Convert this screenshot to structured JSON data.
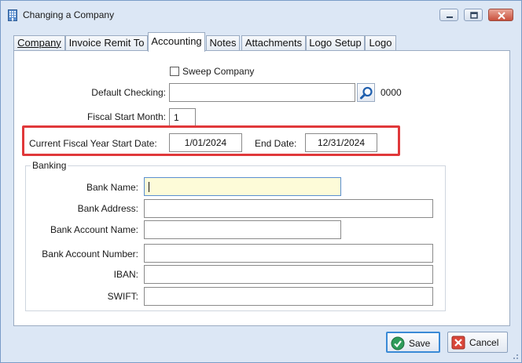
{
  "window": {
    "title": "Changing a Company",
    "icon": "building-icon"
  },
  "tabs": [
    {
      "label": "Company",
      "active": false
    },
    {
      "label": "Invoice Remit To",
      "active": false
    },
    {
      "label": "Accounting",
      "active": true
    },
    {
      "label": "Notes",
      "active": false
    },
    {
      "label": "Attachments",
      "active": false
    },
    {
      "label": "Logo Setup",
      "active": false
    },
    {
      "label": "Logo",
      "active": false
    }
  ],
  "accounting": {
    "sweep_company_label": "Sweep Company",
    "sweep_company_checked": false,
    "default_checking_label": "Default Checking:",
    "default_checking_value": "",
    "default_checking_code": "0000",
    "fiscal_start_month_label": "Fiscal Start Month:",
    "fiscal_start_month_value": "1",
    "fy_start_label": "Current Fiscal Year Start Date:",
    "fy_start_value": "1/01/2024",
    "end_date_label": "End Date:",
    "end_date_value": "12/31/2024",
    "highlight_color": "#e0383a"
  },
  "banking": {
    "group_title": "Banking",
    "bank_name_label": "Bank Name:",
    "bank_name_value": "",
    "bank_address_label": "Bank Address:",
    "bank_address_value": "",
    "bank_account_name_label": "Bank Account Name:",
    "bank_account_name_value": "",
    "bank_account_number_label": "Bank Account Number:",
    "bank_account_number_value": "",
    "iban_label": "IBAN:",
    "iban_value": "",
    "swift_label": "SWIFT:",
    "swift_value": ""
  },
  "buttons": {
    "save_label": "Save",
    "cancel_label": "Cancel"
  }
}
